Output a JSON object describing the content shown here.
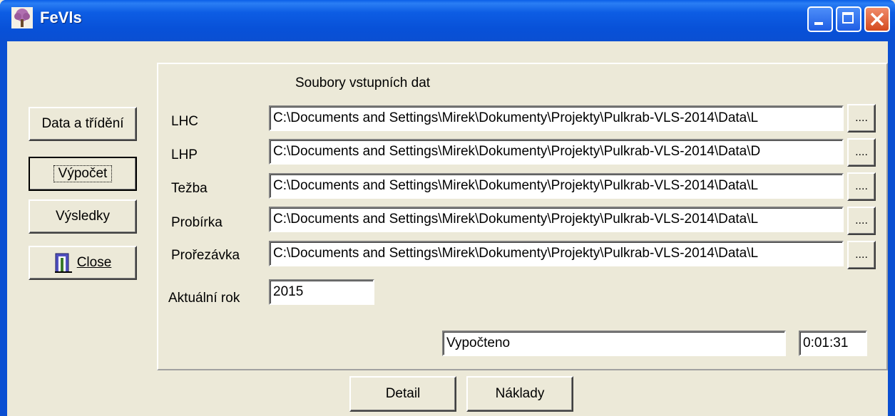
{
  "window": {
    "title": "FeVls"
  },
  "sidebar": {
    "data_label": "Data a třídění",
    "calc_label": "Výpočet",
    "results_label": "Výsledky",
    "close_label": "Close"
  },
  "panel": {
    "heading": "Soubory vstupních dat",
    "rows": [
      {
        "label": "LHC",
        "value": "C:\\Documents and Settings\\Mirek\\Dokumenty\\Projekty\\Pulkrab-VLS-2014\\Data\\L",
        "browse": "...."
      },
      {
        "label": "LHP",
        "value": "C:\\Documents and Settings\\Mirek\\Dokumenty\\Projekty\\Pulkrab-VLS-2014\\Data\\D",
        "browse": "...."
      },
      {
        "label": "Težba",
        "value": "C:\\Documents and Settings\\Mirek\\Dokumenty\\Projekty\\Pulkrab-VLS-2014\\Data\\L",
        "browse": "...."
      },
      {
        "label": "Probírka",
        "value": "C:\\Documents and Settings\\Mirek\\Dokumenty\\Projekty\\Pulkrab-VLS-2014\\Data\\L",
        "browse": "...."
      },
      {
        "label": "Prořezávka",
        "value": "C:\\Documents and Settings\\Mirek\\Dokumenty\\Projekty\\Pulkrab-VLS-2014\\Data\\L",
        "browse": "...."
      }
    ],
    "year_label": "Aktuální rok",
    "year_value": "2015",
    "status_value": "Vypočteno",
    "time_value": "0:01:31"
  },
  "bottom": {
    "detail_label": "Detail",
    "costs_label": "Náklady"
  }
}
